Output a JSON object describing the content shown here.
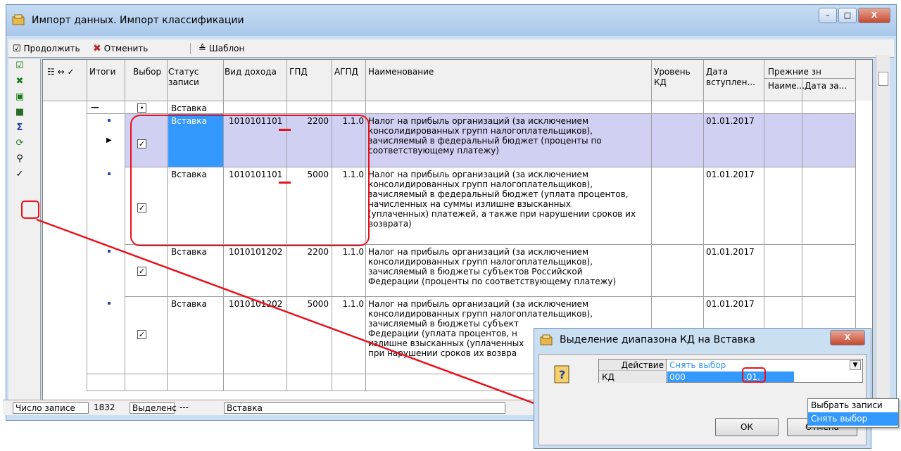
{
  "window": {
    "title": "Импорт данных. Импорт классификации",
    "min": "–",
    "max": "□",
    "close": "X"
  },
  "toolbar": {
    "continue": "Продолжить",
    "cancel": "Отменить",
    "template": "Шаблон"
  },
  "columns": {
    "itogi": "Итоги",
    "vybor": "Выбор",
    "status1": "Статус",
    "status2": "записи",
    "vid": "Вид дохода",
    "gpd": "ГПД",
    "agpd": "АГПД",
    "name": "Наименование",
    "level1": "Уровень",
    "level2": "КД",
    "date1": "Дата",
    "date2": "вступлен...",
    "prev": "Прежние зн",
    "prev_name": "Наиме...",
    "prev_date": "Дата за..."
  },
  "group_row": {
    "status": "Вставка"
  },
  "rows": [
    {
      "status": "Вставка",
      "kd": "1010101101",
      "gpd": "2200",
      "agpd": "1.1.0",
      "name": [
        "Налог на прибыль организаций (за исключением",
        "консолидированных групп налогоплательщиков),",
        "зачисляемый в федеральный бюджет (проценты по",
        "соответствующему платежу)"
      ],
      "date": "01.01.2017"
    },
    {
      "status": "Вставка",
      "kd": "1010101101",
      "gpd": "5000",
      "agpd": "1.1.0",
      "name": [
        "Налог на прибыль организаций (за исключением",
        "консолидированных групп налогоплательщиков),",
        "зачисляемый в федеральный бюджет (уплата процентов,",
        "начисленных на суммы излишне взысканных",
        "(уплаченных) платежей, а также при нарушении сроков их",
        "возврата)"
      ],
      "date": "01.01.2017"
    },
    {
      "status": "Вставка",
      "kd": "1010101202",
      "gpd": "2200",
      "agpd": "1.1.0",
      "name": [
        "Налог на прибыль организаций (за исключением",
        "консолидированных групп налогоплательщиков),",
        "зачисляемый в бюджеты субъектов Российской",
        "Федерации (проценты по соответствующему платежу)"
      ],
      "date": "01.01.2017"
    },
    {
      "status": "Вставка",
      "kd": "1010101202",
      "gpd": "5000",
      "agpd": "1.1.0",
      "name": [
        "Налог на прибыль организаций (за исключением",
        "консолидированных групп налогоплательщиков),",
        "зачисляемый в бюджеты субъект",
        "Федерации (уплата процентов, н",
        "излишне взысканных (уплаченных",
        "при нарушении сроков их возвра"
      ],
      "date": "01.01.2017"
    }
  ],
  "status": {
    "count_label": "Число записе",
    "count": "1832",
    "selected_label": "Выделенс",
    "selected": "---",
    "mode": "Вставка"
  },
  "dialog": {
    "title": "Выделение диапазона КД на Вставка",
    "action_label": "Действие",
    "action_value": "Снять выбор",
    "kd_label": "КД",
    "kd_prefix": "000",
    "kd_mid": ".01.",
    "ok": "ОК",
    "cancel": "Отмена",
    "close": "X"
  },
  "popup": {
    "items": [
      "Выбрать записи",
      "Снять выбор"
    ]
  },
  "colors": {
    "accent": "#3399ff",
    "annotation": "#e8121d",
    "selection": "#cfd0f2"
  }
}
